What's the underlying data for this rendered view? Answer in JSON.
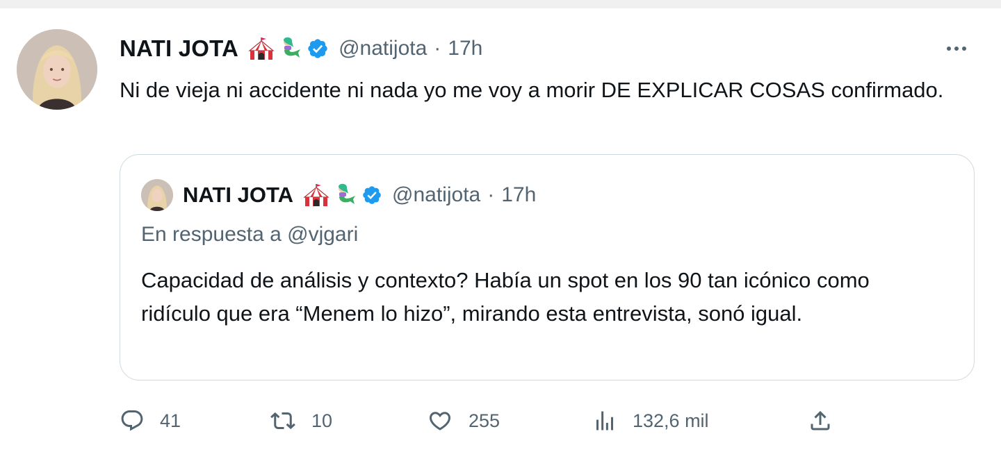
{
  "tweet": {
    "author_name": "NATI JOTA",
    "author_emojis": [
      "circus-tent-icon",
      "mermaid-icon"
    ],
    "handle": "@natijota",
    "separator": "·",
    "time": "17h",
    "text": "Ni de vieja ni accidente ni nada yo me voy a morir DE EXPLICAR COSAS confirmado.",
    "verified_color": "#1d9bf0",
    "quoted": {
      "author_name": "NATI JOTA",
      "handle": "@natijota",
      "separator": "·",
      "time": "17h",
      "reply_to": "En respuesta a @vjgari",
      "text": "Capacidad de análisis y contexto? Había un spot en los 90 tan icónico como ridículo que era “Menem lo hizo”, mirando esta entrevista, sonó igual."
    },
    "actions": {
      "replies": "41",
      "retweets": "10",
      "likes": "255",
      "views": "132,6 mil"
    }
  }
}
